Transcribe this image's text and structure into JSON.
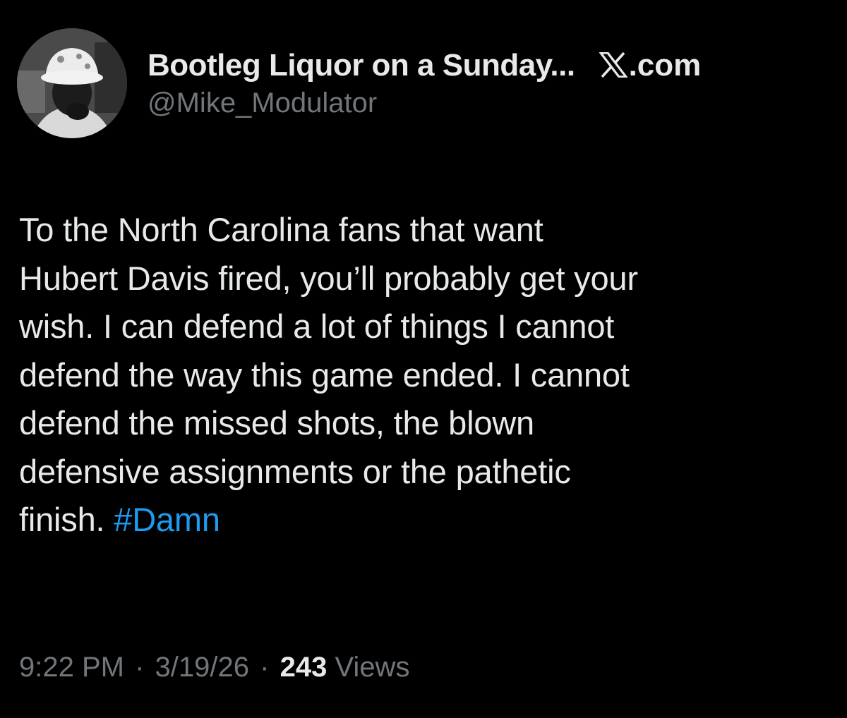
{
  "author": {
    "display_name": "Bootleg Liquor on a Sunday...",
    "handle": "@Mike_Modulator",
    "avatar_icon": "avatar-photo"
  },
  "brand": {
    "icon": "x-logo-icon",
    "domain_suffix": ".com"
  },
  "tweet": {
    "lines": [
      "To the North Carolina fans that want",
      "Hubert Davis fired, you’ll probably get your",
      "wish. I can defend a lot of things I cannot",
      "defend the way this game ended. I cannot",
      "defend the missed shots, the blown",
      "defensive assignments or the pathetic"
    ],
    "last_line_text": "finish.",
    "hashtag": "#Damn"
  },
  "meta": {
    "time": "9:22 PM",
    "separator": "·",
    "date": "3/19/26",
    "views_count": "243",
    "views_label": "Views"
  },
  "colors": {
    "background": "#000000",
    "text": "#e7e9ea",
    "secondary": "#71767b",
    "link": "#1d9bf0"
  }
}
